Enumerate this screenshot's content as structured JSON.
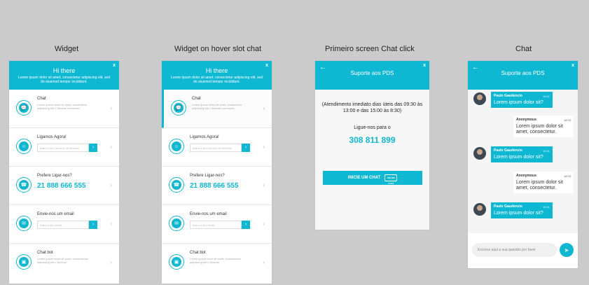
{
  "columns": {
    "widget": "Widget",
    "hover": "Widget on hover slot chat",
    "screen": "Primeiro screen Chat click",
    "chat": "Chat"
  },
  "widget": {
    "close": "x",
    "title": "Hi there",
    "subtitle": "Lorem ipsum dolor sit amet, consectetur adipiscing elit, sed do eiusmod tempor incididunt.",
    "items": [
      {
        "title": "Chat",
        "sub": "Lorem ipsum dolor sit amet, consectetur adipiscing elit // Aenean commodo",
        "icon": "chat-bubble-icon"
      },
      {
        "title": "Ligamos Agora!",
        "placeholder": "Insira o seu número de telefone",
        "icon": "agent-icon"
      },
      {
        "title": "Prefere Ligar-nos?",
        "phone": "21 888 666 555",
        "icon": "phone-icon"
      },
      {
        "title": "Envie-nos um email",
        "placeholder": "Insira o seu email",
        "icon": "envelope-icon"
      },
      {
        "title": "Chat bot",
        "sub": "Lorem ipsum dolor sit amet, consectetuer adipiscing elit // Aenean",
        "icon": "robot-icon"
      }
    ]
  },
  "screen": {
    "title": "Suporte aos PDS",
    "close": "x",
    "back": "←",
    "hours": "(Atendimento imediato dias úteis das 09:30 às 13:00 e das 15:00 às 8:30)",
    "call_label": "Ligue-nos para o",
    "number": "308 811 899",
    "button": "INICIE UM CHAT",
    "button_icon_text": "ONLINE CHAT"
  },
  "chat": {
    "title": "Suporte aos PDS",
    "close": "x",
    "back": "←",
    "messages": [
      {
        "from": "agent",
        "name": "Paulo Gaudencio",
        "time": "16:01",
        "text": "Lorem ipsum dolor sit?"
      },
      {
        "from": "user",
        "name": "Anonymous",
        "time": "16:03",
        "text": "Lorem ipsum dolor sit amet, consectetur."
      },
      {
        "from": "agent",
        "name": "Paulo Gaudencio",
        "time": "16:01",
        "text": "Lorem ipsum dolor sit?"
      },
      {
        "from": "user",
        "name": "Anonymous",
        "time": "16:03",
        "text": "Lorem ipsum dolor sit amet, consectetur."
      },
      {
        "from": "agent",
        "name": "Paulo Gaudencio",
        "time": "16:01",
        "text": "Lorem ipsum dolor sit?"
      }
    ],
    "input_placeholder": "Escreva aqui a sua questão por favor"
  },
  "icons": {
    "chevron": "›",
    "arrow": "›",
    "send": "➤"
  },
  "colors": {
    "accent": "#0fb8d2",
    "background": "#cbcbcb"
  }
}
